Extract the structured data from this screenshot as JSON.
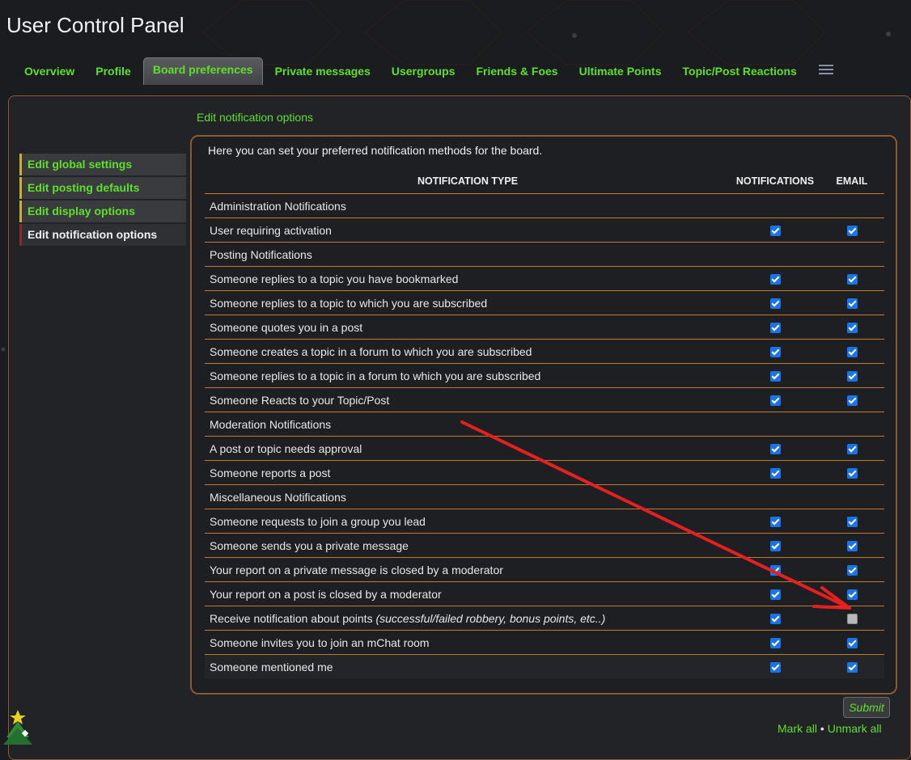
{
  "page_title": "User Control Panel",
  "tabs": [
    {
      "label": "Overview"
    },
    {
      "label": "Profile"
    },
    {
      "label": "Board preferences",
      "active": true
    },
    {
      "label": "Private messages"
    },
    {
      "label": "Usergroups"
    },
    {
      "label": "Friends & Foes"
    },
    {
      "label": "Ultimate Points"
    },
    {
      "label": "Topic/Post Reactions"
    }
  ],
  "menu_icon": "hamburger-icon",
  "sidenav": [
    {
      "label": "Edit global settings"
    },
    {
      "label": "Edit posting defaults"
    },
    {
      "label": "Edit display options"
    },
    {
      "label": "Edit notification options",
      "active": true
    }
  ],
  "section_heading": "Edit notification options",
  "intro": "Here you can set your preferred notification methods for the board.",
  "table": {
    "headers": [
      "NOTIFICATION TYPE",
      "NOTIFICATIONS",
      "EMAIL"
    ],
    "groups": [
      {
        "title": "Administration Notifications",
        "rows": [
          {
            "label": "User requiring activation",
            "notify": true,
            "email": true
          }
        ]
      },
      {
        "title": "Posting Notifications",
        "rows": [
          {
            "label": "Someone replies to a topic you have bookmarked",
            "notify": true,
            "email": true
          },
          {
            "label": "Someone replies to a topic to which you are subscribed",
            "notify": true,
            "email": true
          },
          {
            "label": "Someone quotes you in a post",
            "notify": true,
            "email": true
          },
          {
            "label": "Someone creates a topic in a forum to which you are subscribed",
            "notify": true,
            "email": true
          },
          {
            "label": "Someone replies to a topic in a forum to which you are subscribed",
            "notify": true,
            "email": true
          },
          {
            "label": "Someone Reacts to your Topic/Post",
            "notify": true,
            "email": true
          }
        ]
      },
      {
        "title": "Moderation Notifications",
        "rows": [
          {
            "label": "A post or topic needs approval",
            "notify": true,
            "email": true
          },
          {
            "label": "Someone reports a post",
            "notify": true,
            "email": true
          }
        ]
      },
      {
        "title": "Miscellaneous Notifications",
        "rows": [
          {
            "label": "Someone requests to join a group you lead",
            "notify": true,
            "email": true
          },
          {
            "label": "Someone sends you a private message",
            "notify": true,
            "email": true
          },
          {
            "label": "Your report on a private message is closed by a moderator",
            "notify": true,
            "email": true
          },
          {
            "label": "Your report on a post is closed by a moderator",
            "notify": true,
            "email": true
          },
          {
            "label": "Receive notification about points",
            "hint": "(successful/failed robbery, bonus points, etc..)",
            "notify": true,
            "email": false
          },
          {
            "label": "Someone invites you to join an mChat room",
            "notify": true,
            "email": true
          },
          {
            "label": "Someone mentioned me",
            "notify": true,
            "email": true
          }
        ]
      }
    ]
  },
  "submit_label": "Submit",
  "mark_all": "Mark all",
  "separator": "•",
  "unmark_all": "Unmark all",
  "colors": {
    "accent_green": "#5ee02a",
    "border_orange": "#c07a34",
    "checkbox_blue": "#1a73e8",
    "annotation_red": "#e62020"
  }
}
